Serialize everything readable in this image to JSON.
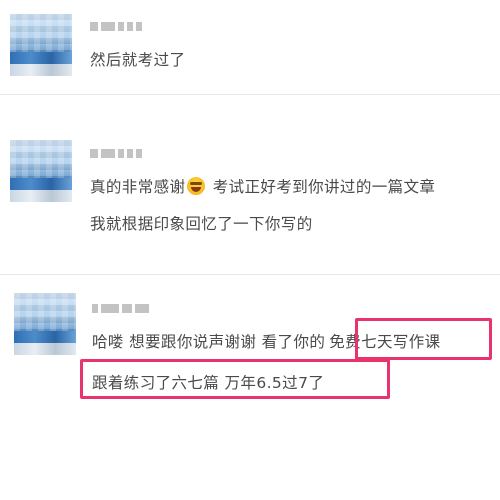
{
  "colors": {
    "text": "#4a4a4a",
    "divider": "#e6e6e6",
    "highlight": "#e8336c"
  },
  "comments": [
    {
      "lines": [
        "然后就考过了"
      ]
    },
    {
      "lines": [
        "真的非常感谢",
        "考试正好考到你讲过的一篇文章",
        "我就根据印象回忆了一下你写的"
      ],
      "emoji": "laughing-tears-emoji"
    },
    {
      "lines": [
        "哈喽 想要跟你说声谢谢 看了你的",
        "免费七天写作课",
        "跟着练习了六七篇 万年6.5过7了"
      ]
    }
  ]
}
